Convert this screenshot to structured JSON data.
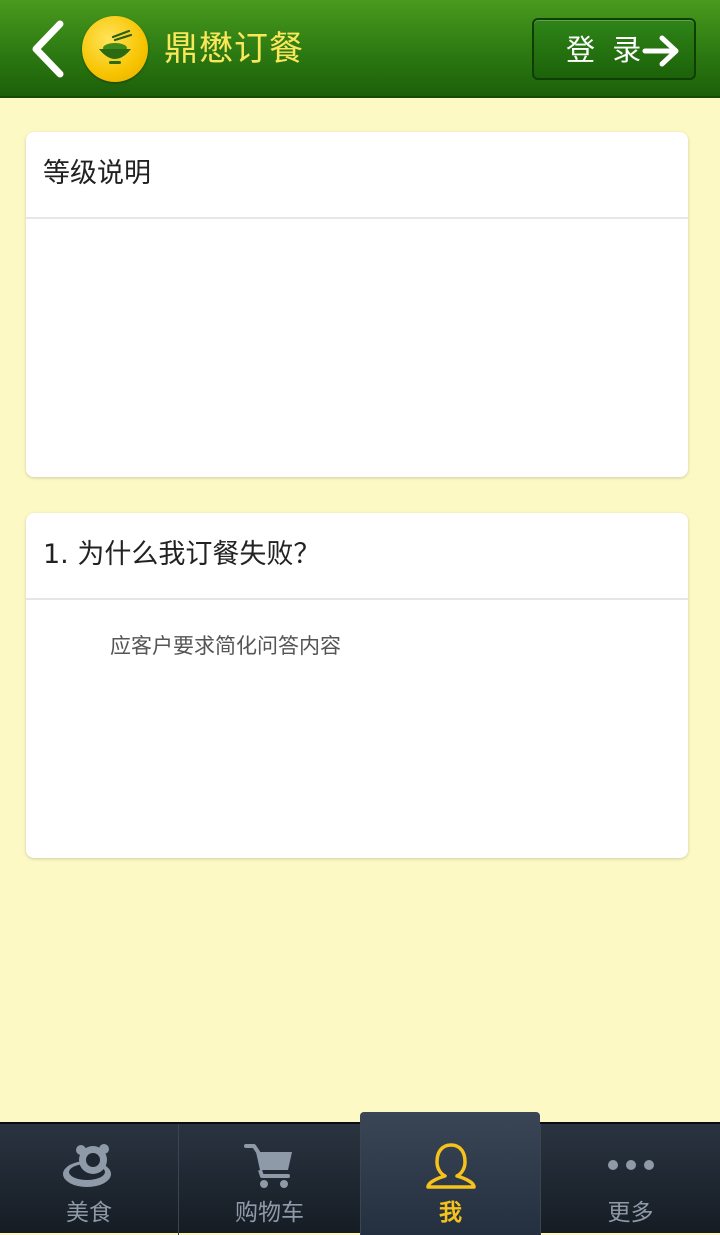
{
  "header": {
    "app_title": "鼎懋订餐",
    "login_label": "登 录",
    "back_icon": "chevron-left-icon",
    "logo_icon": "rice-bowl-icon",
    "login_icon": "arrow-right-icon",
    "colors": {
      "bar": "#2c7a12",
      "title": "#fbe75a",
      "logo": "#f7c400"
    }
  },
  "cards": [
    {
      "title": "等级说明",
      "body": ""
    },
    {
      "title": "1. 为什么我订餐失败？",
      "body": "应客户要求简化问答内容"
    }
  ],
  "tabbar": {
    "active_index": 2,
    "active_color": "#f6c21c",
    "inactive_color": "#8f9aa8",
    "items": [
      {
        "label": "美食",
        "icon": "food-icon"
      },
      {
        "label": "购物车",
        "icon": "cart-icon"
      },
      {
        "label": "我",
        "icon": "user-icon"
      },
      {
        "label": "更多",
        "icon": "more-dots-icon"
      }
    ]
  },
  "page": {
    "background": "#fdf9c4"
  }
}
